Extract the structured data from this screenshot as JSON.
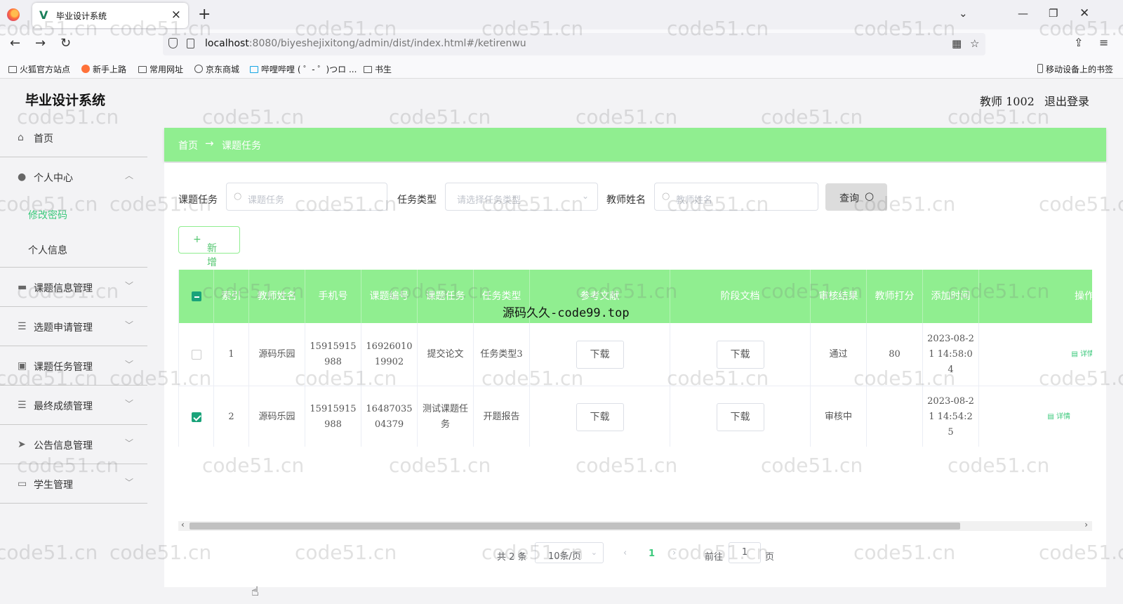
{
  "browser": {
    "tab_title": "毕业设计系统",
    "url_host": "localhost",
    "url_path": ":8080/biyeshejixitong/admin/dist/index.html#/ketirenwu",
    "bookmarks": [
      "火狐官方站点",
      "新手上路",
      "常用网址",
      "京东商城",
      "哔哩哔哩 ( ゜- ゜)つロ ...",
      "书生"
    ],
    "mobile_bookmarks": "移动设备上的书签"
  },
  "header": {
    "brand": "毕业设计系统",
    "user": "教师 1002",
    "logout": "退出登录"
  },
  "sidebar": {
    "home": "首页",
    "personal": "个人中心",
    "personal_items": [
      "修改密码",
      "个人信息"
    ],
    "menus": [
      "课题信息管理",
      "选题申请管理",
      "课题任务管理",
      "最终成绩管理",
      "公告信息管理",
      "学生管理"
    ]
  },
  "breadcrumb": {
    "home": "首页",
    "separator": "→",
    "current": "课题任务"
  },
  "filters": {
    "task_label": "课题任务",
    "task_placeholder": "课题任务",
    "type_label": "任务类型",
    "type_placeholder": "请选择任务类型",
    "teacher_label": "教师姓名",
    "teacher_placeholder": "教师姓名",
    "query_button": "查询",
    "add_button": "新增"
  },
  "table": {
    "headers": [
      "索引",
      "教师姓名",
      "手机号",
      "课题编号",
      "课题任务",
      "任务类型",
      "参考文献",
      "阶段文档",
      "审核结果",
      "教师打分",
      "添加时间",
      "操作"
    ],
    "rows": [
      {
        "index": "1",
        "teacher": "源码乐园",
        "phone": "15915915988",
        "code": "1692601019902",
        "task": "提交论文",
        "type": "任务类型3",
        "ref": "下载",
        "doc": "下载",
        "result": "通过",
        "score": "80",
        "time": "2023-08-21 14:58:04",
        "action": "详情",
        "checked": false
      },
      {
        "index": "2",
        "teacher": "源码乐园",
        "phone": "15915915988",
        "code": "1648703504379",
        "task": "测试课题任务",
        "type": "开题报告",
        "ref": "下载",
        "doc": "下载",
        "result": "审核中",
        "score": "",
        "time": "2023-08-21 14:54:25",
        "action": "详情",
        "checked": true
      }
    ]
  },
  "pagination": {
    "total": "共 2 条",
    "page_size": "10条/页",
    "current_page": "1",
    "goto": "前往",
    "goto_value": "1",
    "page_suffix": "页"
  },
  "overlay_text": "源码久久-code99.top",
  "watermark": "code51.cn",
  "colors": {
    "accent": "#90ee90",
    "active_text": "#3cc97c",
    "checkbox": "#1aa37a"
  }
}
